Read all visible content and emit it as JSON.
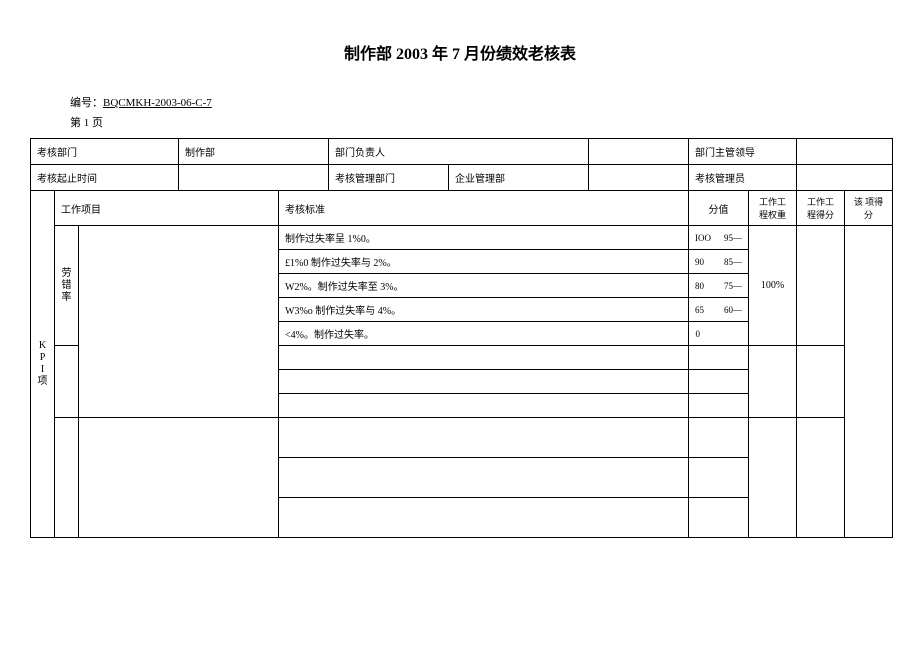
{
  "title": "制作部 2003 年 7 月份绩效老核表",
  "meta": {
    "label_number": "编号：",
    "doc_number": "BQCMKH-2003-06-C-7",
    "page_label": "第 1 页"
  },
  "header1": {
    "dept_label": "考核部门",
    "dept_value": "制作部",
    "owner_label": "部门负责人",
    "owner_value": "",
    "leader_label": "部门主管领导",
    "leader_value": ""
  },
  "header2": {
    "time_label": "考核起止时间",
    "time_value": "",
    "mgmt_dept_label": "考核管理部门",
    "mgmt_dept_value": "企业管理部",
    "manager_label": "考核管理员",
    "manager_value": ""
  },
  "columns": {
    "item": "工作项目",
    "criteria": "考核标准",
    "score": "分值",
    "weight": "工作工程权重",
    "got": "工作工程得分",
    "total": "该 项得分"
  },
  "kpi_label": "K P I 项",
  "row_label_1": "劳错率",
  "rows": [
    {
      "criteria": "制作过失率呈 1%0。",
      "score_top": "95—",
      "score_bottom": "IOO"
    },
    {
      "criteria": "£1%0 制作过失率与 2%。",
      "score_top": "85—",
      "score_bottom": "90"
    },
    {
      "criteria": "W2%。制作过失率至 3%。",
      "score_top": "75—",
      "score_bottom": "80"
    },
    {
      "criteria": "W3%o 制作过失率与 4%。",
      "score_top": "60—",
      "score_bottom": "65"
    },
    {
      "criteria": "<4%。制作过失率。",
      "score_top": "",
      "score_bottom": "0"
    }
  ],
  "weight_value": "100%"
}
